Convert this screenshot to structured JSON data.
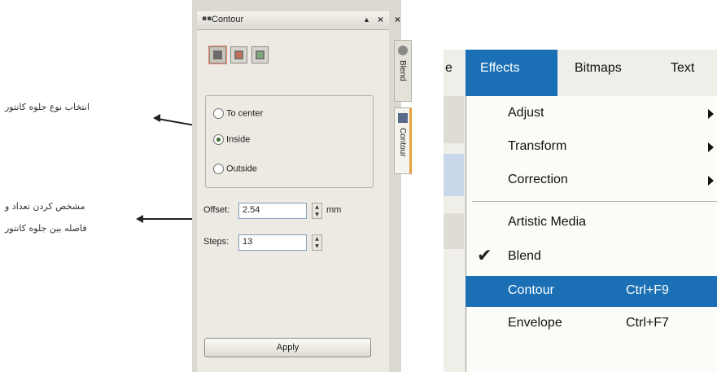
{
  "annotations": {
    "mode_selection": "انتخاب نوع جلوه کانتور",
    "offset_steps_line1": "مشخص کردن تعداد و",
    "offset_steps_line2": "فاصله بین جلوه کانتور"
  },
  "docker": {
    "title": "Contour",
    "titlebar_buttons": [
      "▲",
      "×",
      "×"
    ],
    "tabs": [
      {
        "label": "Blend",
        "icon": "blend-icon"
      },
      {
        "label": "Contour",
        "icon": "contour-icon"
      }
    ],
    "direction_options": [
      {
        "label": "To center",
        "selected": false
      },
      {
        "label": "Inside",
        "selected": true
      },
      {
        "label": "Outside",
        "selected": false
      }
    ],
    "offset": {
      "label": "Offset:",
      "value": "2.54",
      "unit": "mm"
    },
    "steps": {
      "label": "Steps:",
      "value": "13"
    },
    "apply_label": "Apply"
  },
  "menubar": {
    "items": [
      {
        "label": "e",
        "active": false
      },
      {
        "label": "Effects",
        "active": true
      },
      {
        "label": "Bitmaps",
        "active": false
      },
      {
        "label": "Text",
        "active": false
      }
    ]
  },
  "effects_menu": [
    {
      "label": "Adjust",
      "shortcut": "",
      "submenu": true,
      "checked": false,
      "highlighted": false
    },
    {
      "label": "Transform",
      "shortcut": "",
      "submenu": true,
      "checked": false,
      "highlighted": false
    },
    {
      "label": "Correction",
      "shortcut": "",
      "submenu": true,
      "checked": false,
      "highlighted": false
    },
    {
      "label": "Artistic Media",
      "shortcut": "",
      "submenu": false,
      "checked": false,
      "highlighted": false
    },
    {
      "label": "Blend",
      "shortcut": "",
      "submenu": false,
      "checked": true,
      "highlighted": false
    },
    {
      "label": "Contour",
      "shortcut": "Ctrl+F9",
      "submenu": false,
      "checked": false,
      "highlighted": true
    },
    {
      "label": "Envelope",
      "shortcut": "Ctrl+F7",
      "submenu": false,
      "checked": false,
      "highlighted": false
    }
  ],
  "colors": {
    "highlight": "#1a6fb5",
    "panel": "#eceae2"
  }
}
